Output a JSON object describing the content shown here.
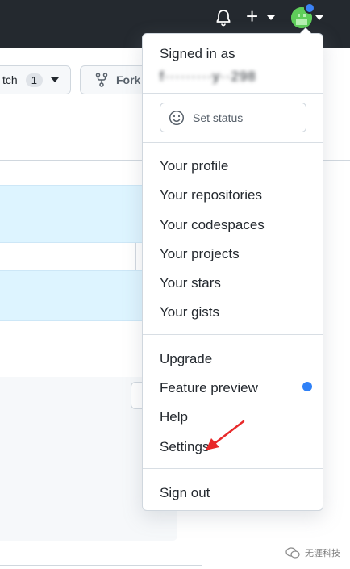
{
  "header": {
    "notifications_icon": "bell-icon",
    "create_icon": "plus-icon",
    "create_symbol": "+",
    "avatar_color": "#5fce5a",
    "status_dot_color": "#3b82f6"
  },
  "background": {
    "watch_label": "tch",
    "watch_count": "1",
    "fork_label": "Fork"
  },
  "menu": {
    "signed_in_label": "Signed in as",
    "username": "f·········y··298",
    "set_status_label": "Set status",
    "group1": [
      "Your profile",
      "Your repositories",
      "Your codespaces",
      "Your projects",
      "Your stars",
      "Your gists"
    ],
    "group2": [
      "Upgrade",
      "Feature preview",
      "Help",
      "Settings"
    ],
    "sign_out": "Sign out",
    "feature_dot_color": "#2f81f7"
  },
  "annotation": {
    "arrow_color": "#e8292a"
  },
  "watermark": {
    "text": "无涯科技"
  }
}
